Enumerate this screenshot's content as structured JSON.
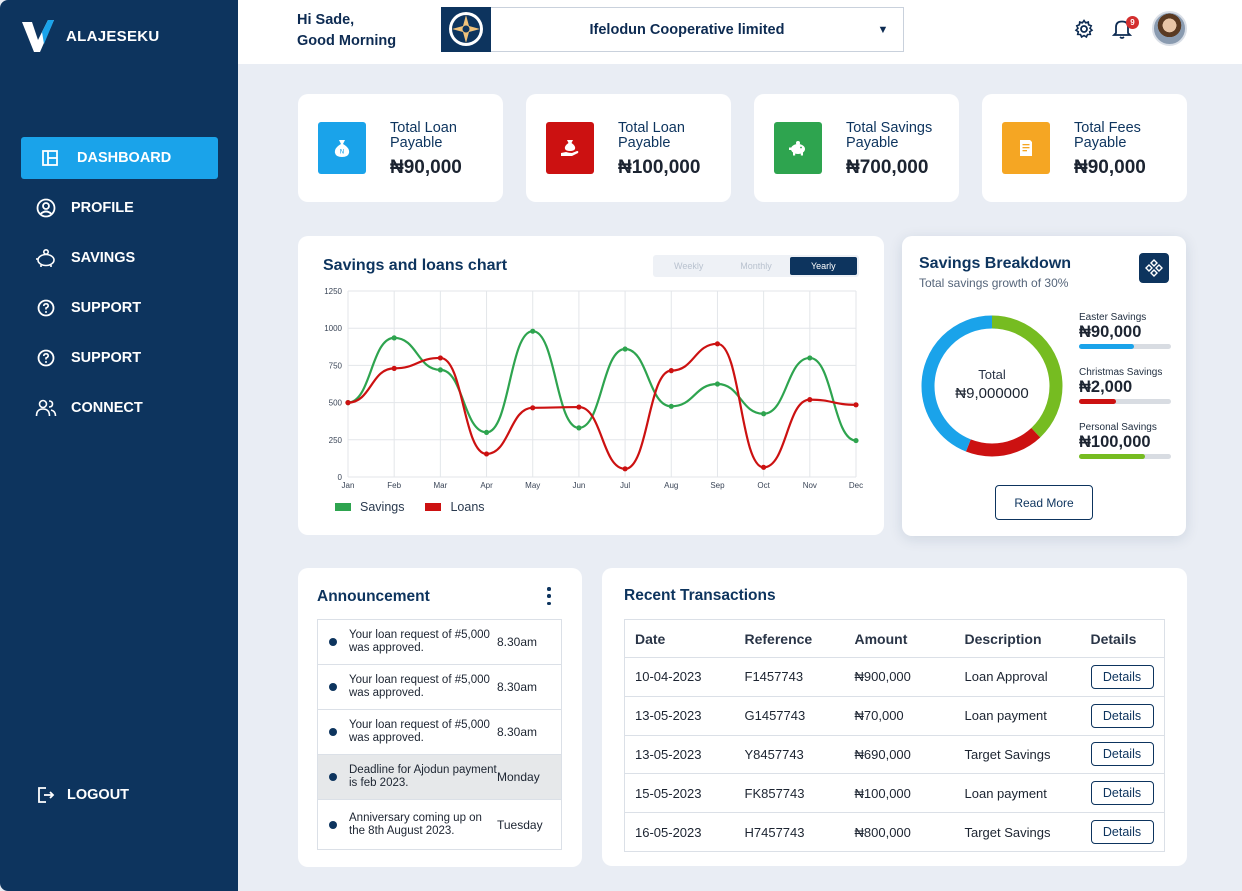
{
  "app": {
    "brand": "ALAJESEKU"
  },
  "sidebar": {
    "items": [
      {
        "label": "DASHBOARD",
        "icon": "dashboard-icon",
        "active": true
      },
      {
        "label": "PROFILE",
        "icon": "user-circle-icon"
      },
      {
        "label": "SAVINGS",
        "icon": "piggy-bank-icon"
      },
      {
        "label": "SUPPORT",
        "icon": "help-icon"
      },
      {
        "label": "SUPPORT",
        "icon": "help-icon"
      },
      {
        "label": "CONNECT",
        "icon": "users-icon"
      }
    ],
    "logout": "LOGOUT"
  },
  "header": {
    "greeting_line1": "Hi Sade,",
    "greeting_line2": "Good Morning",
    "organization": "Ifelodun Cooperative limited",
    "notification_count": "9"
  },
  "stats": [
    {
      "label": "Total Loan Payable",
      "value": "₦90,000",
      "color": "#1aa3ea",
      "icon": "money-bag-icon"
    },
    {
      "label": "Total Loan Payable",
      "value": "₦100,000",
      "color": "#cc1111",
      "icon": "money-hand-icon"
    },
    {
      "label": "Total Savings Payable",
      "value": "₦700,000",
      "color": "#2ea44f",
      "icon": "piggy-bank-icon"
    },
    {
      "label": "Total Fees Payable",
      "value": "₦90,000",
      "color": "#f5a623",
      "icon": "receipt-icon"
    }
  ],
  "savings_chart": {
    "title": "Savings and loans chart",
    "tabs": [
      "Weekly",
      "Monthly",
      "Yearly"
    ],
    "active_tab": "Yearly"
  },
  "chart_data": {
    "type": "line",
    "categories": [
      "Jan",
      "Feb",
      "Mar",
      "Apr",
      "May",
      "Jun",
      "Jul",
      "Aug",
      "Sep",
      "Oct",
      "Nov",
      "Dec"
    ],
    "ylim": [
      0,
      1250
    ],
    "yticks": [
      0,
      250,
      500,
      750,
      1000,
      1250
    ],
    "grid": true,
    "legend": "bottom-left",
    "series": [
      {
        "name": "Savings",
        "color": "#2ea44f",
        "values": [
          500,
          935,
          720,
          300,
          980,
          330,
          860,
          475,
          625,
          425,
          800,
          245
        ]
      },
      {
        "name": "Loans",
        "color": "#cc1111",
        "values": [
          500,
          730,
          800,
          155,
          465,
          470,
          55,
          715,
          895,
          65,
          520,
          485
        ]
      }
    ]
  },
  "breakdown": {
    "title": "Savings Breakdown",
    "subtitle": "Total savings growth of 30%",
    "total_label": "Total",
    "total_value": "₦9,000000",
    "ring": [
      {
        "color": "#76bc21",
        "fraction": 0.38
      },
      {
        "color": "#cc1111",
        "fraction": 0.18
      },
      {
        "color": "#1aa3ea",
        "fraction": 0.44
      }
    ],
    "items": [
      {
        "name": "Easter Savings",
        "value": "₦90,000",
        "color": "#1aa3ea",
        "progress": 0.6
      },
      {
        "name": "Christmas Savings",
        "value": "₦2,000",
        "color": "#cc1111",
        "progress": 0.4
      },
      {
        "name": "Personal Savings",
        "value": "₦100,000",
        "color": "#76bc21",
        "progress": 0.72
      }
    ],
    "button": "Read More"
  },
  "announcements": {
    "title": "Announcement",
    "items": [
      {
        "text": "Your loan request of #5,000 was approved.",
        "time": "8.30am"
      },
      {
        "text": "Your loan request of #5,000 was approved.",
        "time": "8.30am"
      },
      {
        "text": "Your loan request of #5,000 was approved.",
        "time": "8.30am"
      },
      {
        "text": "Deadline for Ajodun payment is feb 2023.",
        "time": "Monday",
        "highlight": true
      },
      {
        "text": "Anniversary coming up on the 8th August 2023.",
        "time": "Tuesday"
      }
    ]
  },
  "transactions": {
    "title": "Recent Transactions",
    "columns": [
      "Date",
      "Reference",
      "Amount",
      "Description",
      "Details"
    ],
    "button": "Details",
    "rows": [
      {
        "date": "10-04-2023",
        "ref": "F1457743",
        "amount": "₦900,000",
        "desc": "Loan Approval"
      },
      {
        "date": "13-05-2023",
        "ref": "G1457743",
        "amount": "₦70,000",
        "desc": "Loan payment"
      },
      {
        "date": "13-05-2023",
        "ref": "Y8457743",
        "amount": "₦690,000",
        "desc": "Target Savings"
      },
      {
        "date": "15-05-2023",
        "ref": "FK857743",
        "amount": "₦100,000",
        "desc": "Loan payment"
      },
      {
        "date": "16-05-2023",
        "ref": "H7457743",
        "amount": "₦800,000",
        "desc": "Target Savings"
      }
    ]
  }
}
